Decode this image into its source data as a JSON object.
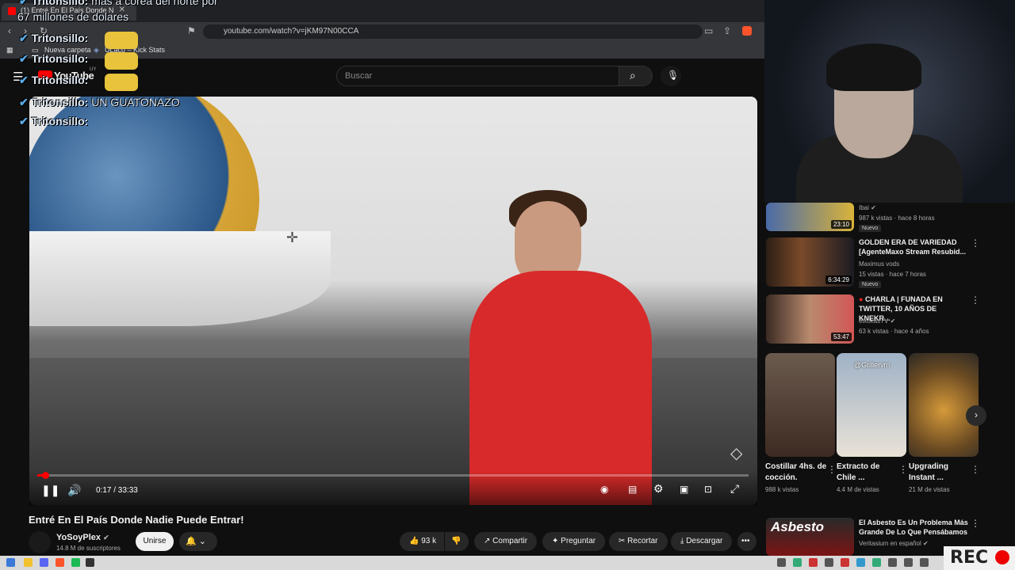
{
  "browser": {
    "tab_title": "(1) Entré En El País Donde N",
    "url": "youtube.com/watch?v=jKM97N00CCA",
    "bookmarks": [
      "Nueva carpeta",
      "ULaco – Kick Stats"
    ]
  },
  "youtube": {
    "logo": "YouTube",
    "country": "UY",
    "search_placeholder": "Buscar"
  },
  "chat_overlay": [
    {
      "user": "Tritonsillo:",
      "text": "más a corea del norte por"
    },
    {
      "user": "",
      "text": "67 millones de dolares"
    },
    {
      "user": "Tritonsillo:",
      "text": ""
    },
    {
      "user": "Tritonsillo:",
      "text": ""
    },
    {
      "user": "Tritonsillo:",
      "text": ""
    },
    {
      "user": "Tritonsillo:",
      "text": "UN GUATONAZO"
    },
    {
      "user": "Tritonsillo:",
      "text": ""
    }
  ],
  "player": {
    "time": "0:17 / 33:33",
    "progress_fraction": 0.0085
  },
  "video": {
    "title": "Entré En El País Donde Nadie Puede Entrar!",
    "channel": "YoSoyPlex",
    "subscribers": "14.8 M de suscriptores",
    "join_label": "Unirse",
    "likes": "93 k",
    "share_label": "Compartir",
    "ask_label": "Preguntar",
    "clip_label": "Recortar",
    "download_label": "Descargar"
  },
  "recommendations": [
    {
      "title": "",
      "channel": "Ibai",
      "meta": "987 k vistas · hace 8 horas",
      "badge": "Nuevo",
      "duration": "23:10"
    },
    {
      "title": "GOLDEN ERA DE VARIEDAD [AgenteMaxo Stream Resubid...",
      "channel": "Maximus vods",
      "meta": "15 vistas · hace 7 horas",
      "badge": "Nuevo",
      "duration": "6:34:29"
    },
    {
      "title": "CHARLA | FUNADA EN TWITTER, 10 AÑOS DE KNEKR...",
      "channel": "elxokasTV",
      "meta": "63 k vistas · hace 4 años",
      "badge": "",
      "duration": "53:47"
    }
  ],
  "shorts": [
    {
      "title": "Costillar 4hs. de cocción.",
      "views": "988 k vistas"
    },
    {
      "title": "Extracto de Chile ...",
      "views": "4.4 M de vistas",
      "overlay": "@Grillervm"
    },
    {
      "title": "Upgrading Instant ...",
      "views": "21 M de vistas"
    }
  ],
  "bottom_rec": {
    "thumb_text": "Asbesto",
    "title": "El Asbesto Es Un Problema Más Grande De Lo Que Pensábamos",
    "channel": "Veritasium en español"
  },
  "rec_label": "REC",
  "colors": {
    "youtube_red": "#ff0000",
    "background": "#0f0f0f",
    "hoodie": "#d82a2a"
  }
}
